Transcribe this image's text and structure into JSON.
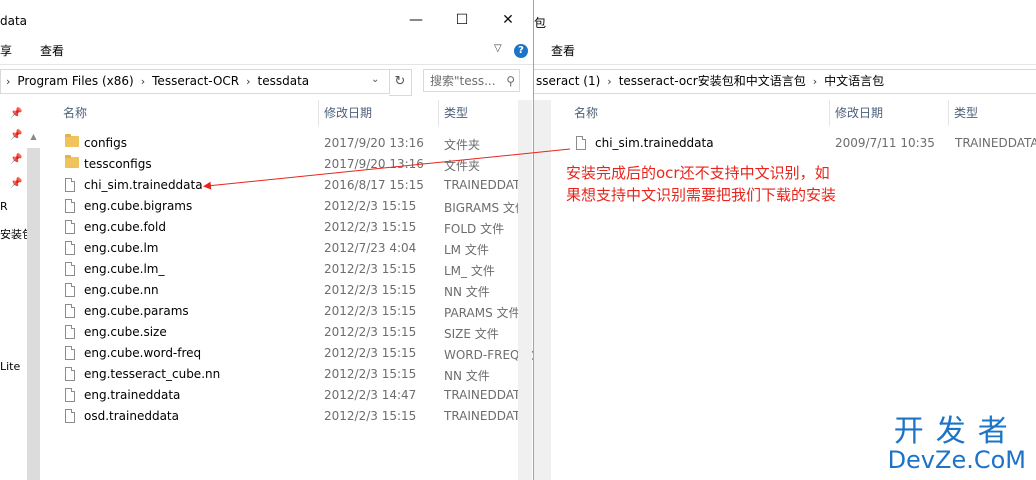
{
  "left": {
    "title": "data",
    "ribbon_tabs": [
      "享",
      "查看"
    ],
    "breadcrumbs": [
      "Program Files (x86)",
      "Tesseract-OCR",
      "tessdata"
    ],
    "search_placeholder": "搜索\"tess...",
    "columns": [
      "名称",
      "修改日期",
      "类型"
    ],
    "nav_texts": [
      "R",
      "安装包",
      "Lite"
    ],
    "files": [
      {
        "name": "configs",
        "date": "2017/9/20 13:16",
        "type": "文件夹",
        "kind": "folder"
      },
      {
        "name": "tessconfigs",
        "date": "2017/9/20 13:16",
        "type": "文件夹",
        "kind": "folder"
      },
      {
        "name": "chi_sim.traineddata",
        "date": "2016/8/17 15:15",
        "type": "TRAINEDDATA",
        "kind": "file"
      },
      {
        "name": "eng.cube.bigrams",
        "date": "2012/2/3 15:15",
        "type": "BIGRAMS 文件",
        "kind": "file"
      },
      {
        "name": "eng.cube.fold",
        "date": "2012/2/3 15:15",
        "type": "FOLD 文件",
        "kind": "file"
      },
      {
        "name": "eng.cube.lm",
        "date": "2012/7/23 4:04",
        "type": "LM 文件",
        "kind": "file"
      },
      {
        "name": "eng.cube.lm_",
        "date": "2012/2/3 15:15",
        "type": "LM_ 文件",
        "kind": "file"
      },
      {
        "name": "eng.cube.nn",
        "date": "2012/2/3 15:15",
        "type": "NN 文件",
        "kind": "file"
      },
      {
        "name": "eng.cube.params",
        "date": "2012/2/3 15:15",
        "type": "PARAMS 文件",
        "kind": "file"
      },
      {
        "name": "eng.cube.size",
        "date": "2012/2/3 15:15",
        "type": "SIZE 文件",
        "kind": "file"
      },
      {
        "name": "eng.cube.word-freq",
        "date": "2012/2/3 15:15",
        "type": "WORD-FREQ 文",
        "kind": "file"
      },
      {
        "name": "eng.tesseract_cube.nn",
        "date": "2012/2/3 15:15",
        "type": "NN 文件",
        "kind": "file"
      },
      {
        "name": "eng.traineddata",
        "date": "2012/2/3 14:47",
        "type": "TRAINEDDATA",
        "kind": "file"
      },
      {
        "name": "osd.traineddata",
        "date": "2012/2/3 15:15",
        "type": "TRAINEDDATA",
        "kind": "file"
      }
    ]
  },
  "right": {
    "title": "包",
    "ribbon_tab": "查看",
    "breadcrumbs": [
      "sseract (1)",
      "tesseract-ocr安装包和中文语言包",
      "中文语言包"
    ],
    "columns": [
      "名称",
      "修改日期",
      "类型"
    ],
    "files": [
      {
        "name": "chi_sim.traineddata",
        "date": "2009/7/11 10:35",
        "type": "TRAINEDDATA",
        "kind": "file"
      }
    ]
  },
  "annotation": {
    "line1": "安装完成后的ocr还不支持中文识别，如",
    "line2": "果想支持中文识别需要把我们下载的安装",
    "color": "#e8251c"
  },
  "watermark": {
    "cn": "开发者",
    "en": "DevZe.CoM",
    "color": "#1c74c8"
  },
  "caption": {
    "minimize": "—",
    "maximize": "☐",
    "close": "✕"
  }
}
